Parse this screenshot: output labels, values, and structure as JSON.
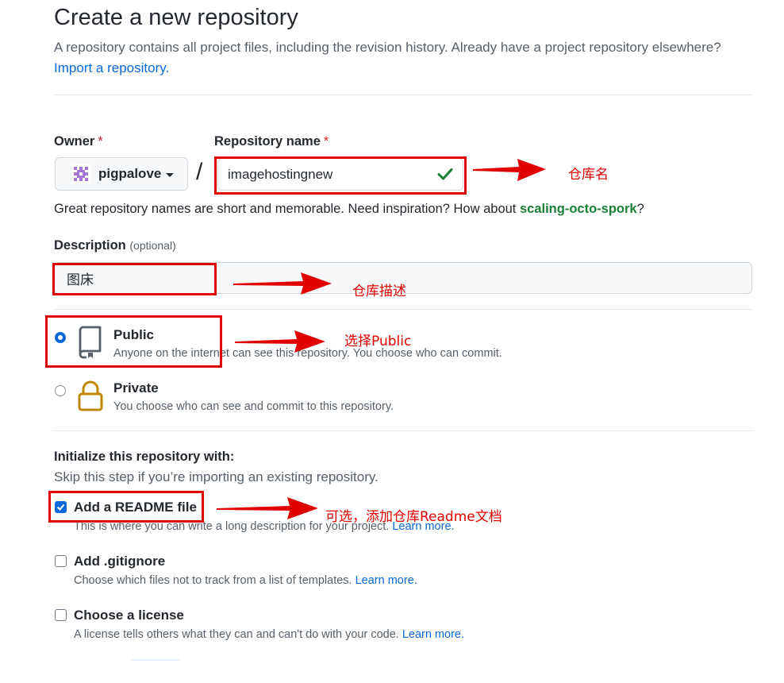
{
  "header": {
    "title": "Create a new repository",
    "subtitle": "A repository contains all project files, including the revision history. Already have a project repository elsewhere?",
    "import_link": "Import a repository."
  },
  "owner": {
    "label": "Owner",
    "required_mark": "*",
    "value": "pigpalove"
  },
  "separator": "/",
  "repo_name": {
    "label": "Repository name",
    "required_mark": "*",
    "value": "imagehostingnew"
  },
  "name_hint": {
    "text": "Great repository names are short and memorable. Need inspiration? How about ",
    "suggestion": "scaling-octo-spork",
    "suffix": "?"
  },
  "description": {
    "label": "Description",
    "optional": "(optional)",
    "value": "图床"
  },
  "visibility": {
    "public": {
      "title": "Public",
      "desc": "Anyone on the internet can see this repository. You choose who can commit."
    },
    "private": {
      "title": "Private",
      "desc": "You choose who can see and commit to this repository."
    }
  },
  "initialize": {
    "title": "Initialize this repository with:",
    "subtitle": "Skip this step if you’re importing an existing repository.",
    "readme": {
      "label": "Add a README file",
      "desc": "This is where you can write a long description for your project.",
      "learn": "Learn more."
    },
    "gitignore": {
      "label": "Add .gitignore",
      "desc": "Choose which files not to track from a list of templates.",
      "learn": "Learn more."
    },
    "license": {
      "label": "Choose a license",
      "desc": "A license tells others what they can and can't do with your code.",
      "learn": "Learn more."
    }
  },
  "annotations": {
    "repo_name": "仓库名",
    "description": "仓库描述",
    "public": "选择Public",
    "readme": "可选，添加仓库Readme文档"
  },
  "colors": {
    "accent": "#0969da",
    "success": "#1a7f37",
    "annotation": "#e00000",
    "lock": "#bf8700"
  },
  "icons": {
    "owner_avatar": "identicon",
    "repo_check": "check-icon",
    "public": "repo-icon",
    "private": "lock-icon",
    "annotation": "arrow-icon"
  }
}
